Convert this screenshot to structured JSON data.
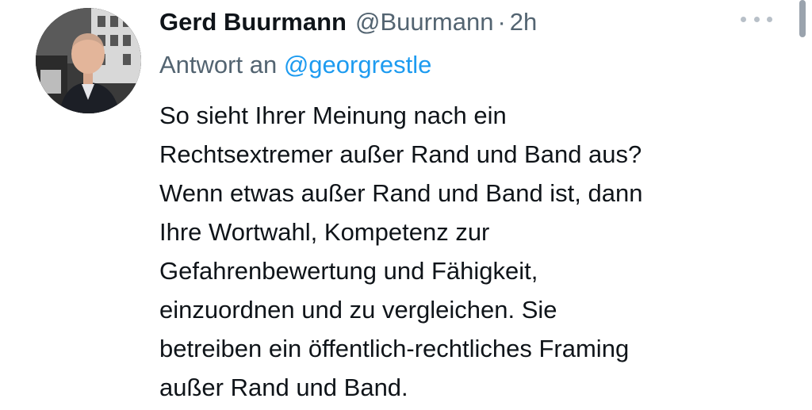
{
  "tweet": {
    "author_name": "Gerd Buurmann",
    "author_handle": "@Buurmann",
    "separator": "·",
    "time": "2h",
    "more_icon": "more-horizontal-icon",
    "reply_prefix": "Antwort an",
    "reply_to_handle": "@georgrestle",
    "text_lines": [
      "So sieht Ihrer Meinung nach ein",
      "Rechtsextremer außer Rand und Band aus?",
      "Wenn etwas außer Rand und Band ist, dann",
      "Ihre Wortwahl, Kompetenz zur",
      "Gefahrenbewertung und Fähigkeit,",
      "einzuordnen und zu vergleichen. Sie",
      "betreiben ein öffentlich-rechtliches Framing",
      "außer Rand und Band."
    ]
  },
  "colors": {
    "text": "#0f1419",
    "secondary": "#536471",
    "link": "#1d9bf0"
  }
}
